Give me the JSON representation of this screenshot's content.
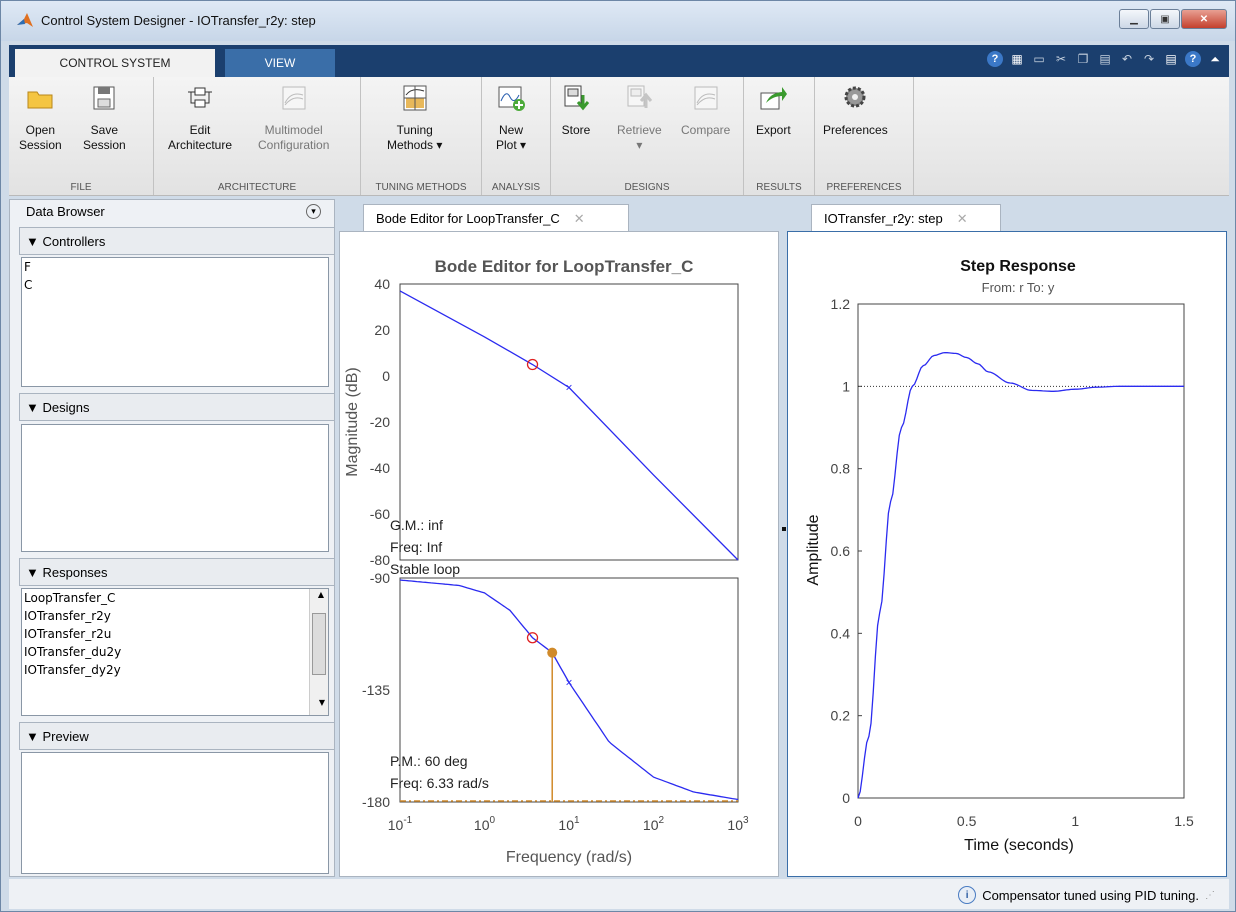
{
  "window": {
    "title": "Control System Designer - IOTransfer_r2y: step"
  },
  "tabs": {
    "control_system": "CONTROL SYSTEM",
    "view": "VIEW"
  },
  "ribbon": {
    "file": {
      "group": "FILE",
      "open": "Open\nSession",
      "save": "Save\nSession"
    },
    "architecture": {
      "group": "ARCHITECTURE",
      "edit": "Edit\nArchitecture",
      "multimodel": "Multimodel\nConfiguration"
    },
    "tuning": {
      "group": "TUNING METHODS",
      "tuning_methods": "Tuning\nMethods ▾"
    },
    "analysis": {
      "group": "ANALYSIS",
      "new_plot": "New\nPlot ▾"
    },
    "designs": {
      "group": "DESIGNS",
      "store": "Store",
      "retrieve": "Retrieve\n▾",
      "compare": "Compare"
    },
    "results": {
      "group": "RESULTS",
      "export": "Export"
    },
    "preferences": {
      "group": "PREFERENCES",
      "preferences": "Preferences"
    }
  },
  "data_browser": {
    "title": "Data Browser",
    "controllers_label": "Controllers",
    "controllers": [
      "F",
      "C"
    ],
    "designs_label": "Designs",
    "responses_label": "Responses",
    "responses": [
      "LoopTransfer_C",
      "IOTransfer_r2y",
      "IOTransfer_r2u",
      "IOTransfer_du2y",
      "IOTransfer_dy2y"
    ],
    "preview_label": "Preview"
  },
  "editor_tabs": {
    "bode": "Bode Editor for LoopTransfer_C",
    "step": "IOTransfer_r2y: step"
  },
  "bode": {
    "title": "Bode Editor for LoopTransfer_C",
    "xlabel": "Frequency (rad/s)",
    "mag_ylabel": "Magnitude (dB)",
    "phase_ylabel": "Phase (deg)",
    "mag_ticks": [
      "40",
      "20",
      "0",
      "-20",
      "-40",
      "-60",
      "-80"
    ],
    "phase_ticks": [
      "-90",
      "-135",
      "-180"
    ],
    "x_ticks": [
      "10",
      "10",
      "10",
      "10",
      "10"
    ],
    "x_exps": [
      "-1",
      "0",
      "1",
      "2",
      "3"
    ],
    "gm": "G.M.: inf",
    "gm_freq": "Freq: Inf",
    "stable": "Stable loop",
    "pm": "P.M.: 60 deg",
    "pm_freq": "Freq: 6.33 rad/s"
  },
  "step": {
    "title": "Step Response",
    "subtitle": "From: r  To: y",
    "ylabel": "Amplitude",
    "xlabel": "Time (seconds)",
    "y_ticks": [
      "1.2",
      "1",
      "0.8",
      "0.6",
      "0.4",
      "0.2",
      "0"
    ],
    "x_ticks": [
      "0",
      "0.5",
      "1",
      "1.5"
    ]
  },
  "status": {
    "message": "Compensator tuned using PID tuning."
  },
  "chart_data": [
    {
      "type": "line",
      "title": "Bode Editor for LoopTransfer_C",
      "xlabel": "Frequency (rad/s)",
      "ylabel": "Magnitude (dB)",
      "xscale": "log",
      "xlim": [
        0.1,
        1000
      ],
      "ylim": [
        -80,
        40
      ],
      "series": [
        {
          "x": [
            0.1,
            1,
            3.7,
            10,
            100,
            1000
          ],
          "y": [
            37,
            17,
            5,
            -5,
            -43,
            -80
          ]
        }
      ],
      "markers": {
        "zero": [
          3.7,
          5
        ],
        "pole": [
          10,
          -5
        ]
      }
    },
    {
      "type": "line",
      "xlabel": "Frequency (rad/s)",
      "ylabel": "Phase (deg)",
      "xscale": "log",
      "xlim": [
        0.1,
        1000
      ],
      "ylim": [
        -180,
        -90
      ],
      "series": [
        {
          "x": [
            0.1,
            0.5,
            1,
            2,
            3.7,
            6.33,
            10,
            30,
            100,
            300,
            1000
          ],
          "y": [
            -90.8,
            -93,
            -96,
            -103,
            -114,
            -120,
            -132,
            -156,
            -170,
            -176,
            -179
          ]
        }
      ],
      "markers": {
        "zero": [
          3.7,
          -114
        ],
        "pole": [
          10,
          -132
        ]
      },
      "phase_margin": {
        "freq": 6.33,
        "phase": -120,
        "pm_deg": 60
      }
    },
    {
      "type": "line",
      "title": "Step Response",
      "subtitle": "From: r  To: y",
      "xlabel": "Time (seconds)",
      "ylabel": "Amplitude",
      "xlim": [
        0,
        1.5
      ],
      "ylim": [
        0,
        1.2
      ],
      "reference": 1,
      "series": [
        {
          "x": [
            0,
            0.05,
            0.1,
            0.15,
            0.2,
            0.25,
            0.3,
            0.35,
            0.4,
            0.45,
            0.5,
            0.55,
            0.6,
            0.7,
            0.8,
            0.9,
            1.0,
            1.1,
            1.2,
            1.3,
            1.5
          ],
          "y": [
            0,
            0.15,
            0.45,
            0.72,
            0.9,
            1.0,
            1.05,
            1.075,
            1.082,
            1.08,
            1.07,
            1.055,
            1.035,
            1.008,
            0.99,
            0.988,
            0.993,
            0.998,
            1.0,
            1.0,
            1.0
          ]
        }
      ]
    }
  ]
}
